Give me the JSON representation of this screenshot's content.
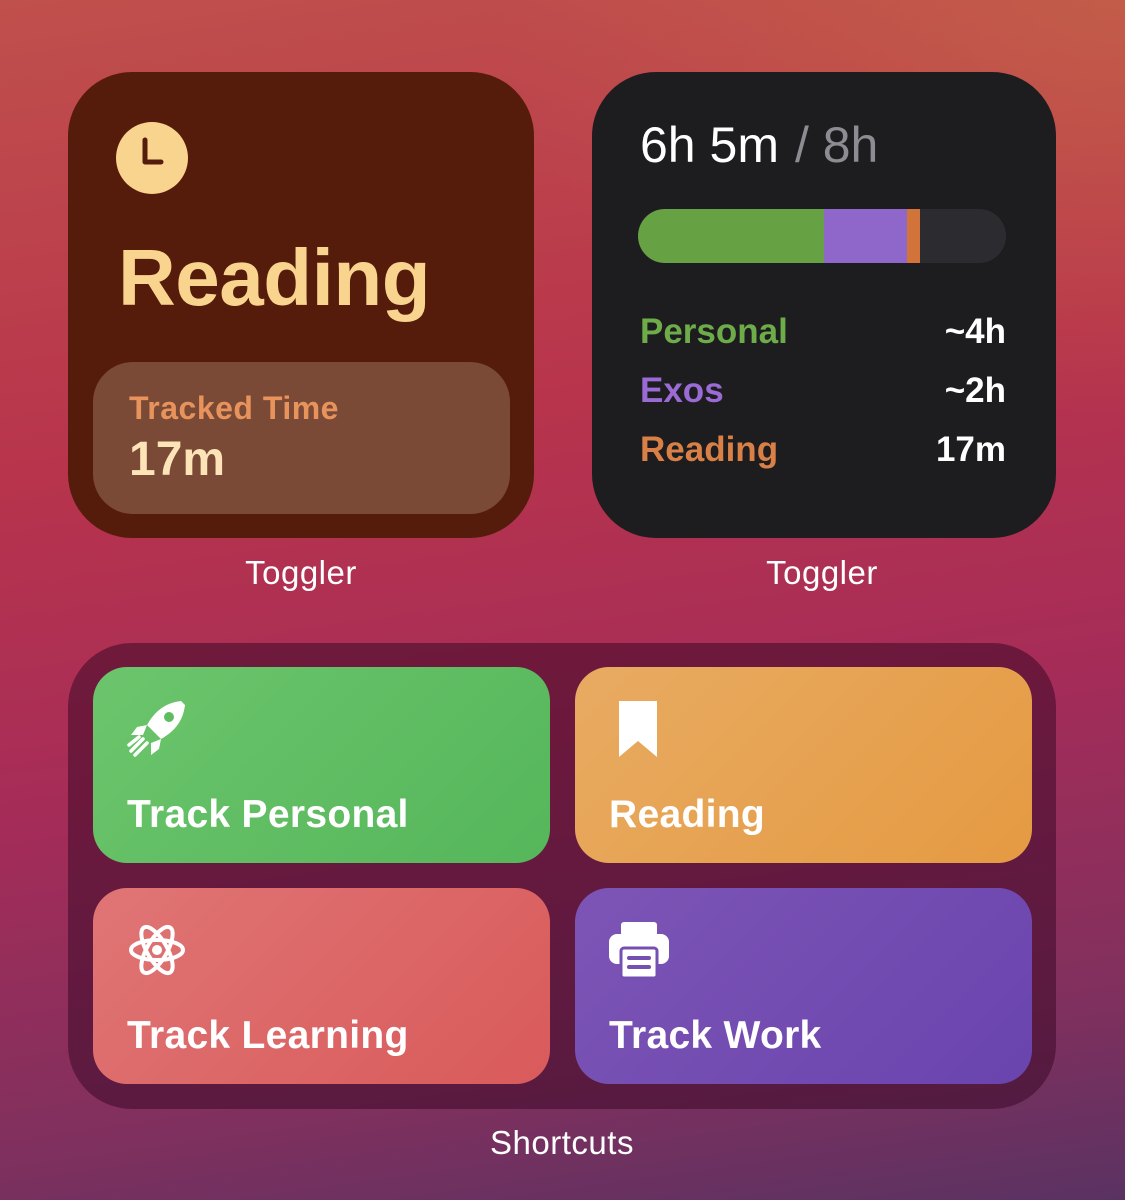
{
  "current_timer": {
    "icon": "clock-icon",
    "title": "Reading",
    "tracked_label": "Tracked Time",
    "tracked_value": "17m",
    "colors": {
      "background": "#561c0b",
      "accent": "#f9d48e"
    },
    "widget_label": "Toggler"
  },
  "summary": {
    "total": "6h 5m",
    "goal": "/ 8h",
    "progress_segments": [
      {
        "name": "Personal",
        "fraction": 0.505,
        "color": "#66a144"
      },
      {
        "name": "Exos",
        "fraction": 0.227,
        "color": "#8f66c9"
      },
      {
        "name": "Reading",
        "fraction": 0.035,
        "color": "#d2733a"
      }
    ],
    "items": [
      {
        "name": "Personal",
        "duration": "~4h",
        "color": "#6dac49"
      },
      {
        "name": "Exos",
        "duration": "~2h",
        "color": "#9a6bd4"
      },
      {
        "name": "Reading",
        "duration": "17m",
        "color": "#d88045"
      }
    ],
    "widget_label": "Toggler"
  },
  "shortcuts": {
    "tiles": [
      {
        "label": "Track Personal",
        "icon": "rocket-icon",
        "color": "#5fbd5f"
      },
      {
        "label": "Reading",
        "icon": "bookmark-icon",
        "color": "#e6a24f"
      },
      {
        "label": "Track Learning",
        "icon": "atom-icon",
        "color": "#dc6767"
      },
      {
        "label": "Track Work",
        "icon": "printer-icon",
        "color": "#7550b2"
      }
    ],
    "widget_label": "Shortcuts"
  }
}
